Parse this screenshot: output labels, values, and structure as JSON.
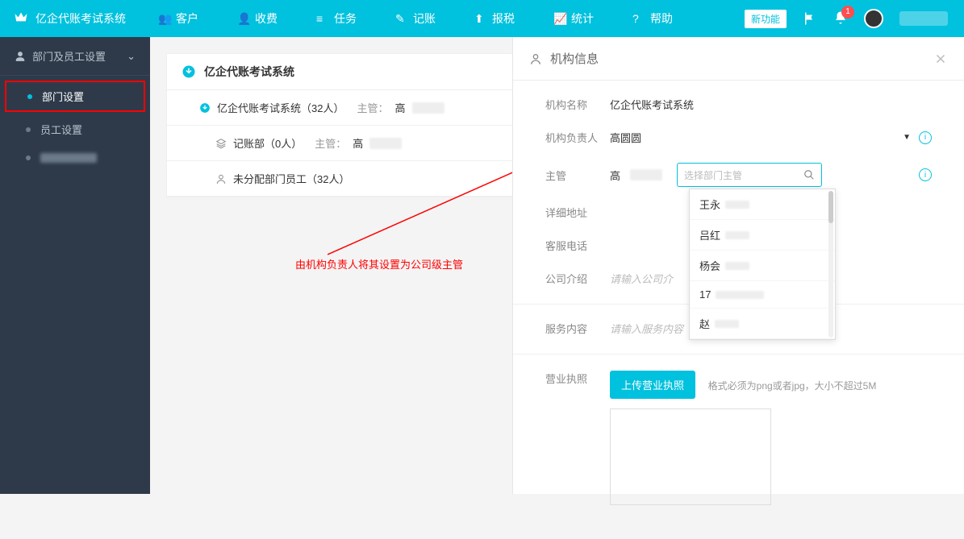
{
  "topbar": {
    "brand": "亿企代账考试系统",
    "nav": [
      {
        "label": "客户"
      },
      {
        "label": "收费"
      },
      {
        "label": "任务"
      },
      {
        "label": "记账"
      },
      {
        "label": "报税"
      },
      {
        "label": "统计"
      },
      {
        "label": "帮助"
      }
    ],
    "new_feature": "新功能",
    "notif_count": "1"
  },
  "sidebar": {
    "section": "部门及员工设置",
    "items": [
      {
        "label": "部门设置"
      },
      {
        "label": "员工设置"
      }
    ]
  },
  "tree": {
    "title": "亿企代账考试系统",
    "rows": [
      {
        "name": "亿企代账考试系统（32人）",
        "mgr_lbl": "主管：",
        "mgr": "高"
      },
      {
        "name": "记账部（0人）",
        "mgr_lbl": "主管：",
        "mgr": "高"
      },
      {
        "name": "未分配部门员工（32人）"
      }
    ]
  },
  "annotation": "由机构负责人将其设置为公司级主管",
  "panel": {
    "title": "机构信息",
    "org_name_lbl": "机构名称",
    "org_name": "亿企代账考试系统",
    "owner_lbl": "机构负责人",
    "owner": "高圆圆",
    "mgr_lbl": "主管",
    "mgr": "高",
    "search_placeholder": "选择部门主管",
    "addr_lbl": "详细地址",
    "phone_lbl": "客服电话",
    "intro_lbl": "公司介绍",
    "intro_ph": "请输入公司介",
    "service_lbl": "服务内容",
    "service_ph": "请输入服务内容",
    "license_lbl": "营业执照",
    "upload_btn": "上传营业执照",
    "upload_hint": "格式必须为png或者jpg，大小不超过5M",
    "dropdown": [
      "王永",
      "吕红",
      "杨会",
      "17",
      "赵"
    ]
  }
}
